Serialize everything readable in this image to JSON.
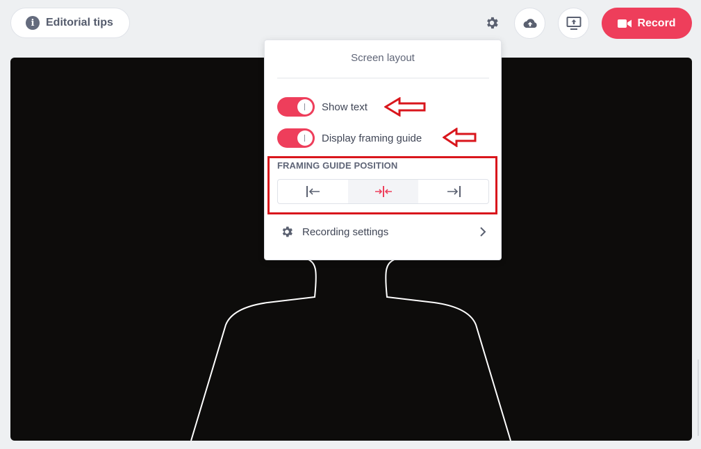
{
  "header": {
    "editorial_tips_label": "Editorial tips",
    "info_icon_glyph": "i",
    "record_label": "Record"
  },
  "popover": {
    "title": "Screen layout",
    "toggles": [
      {
        "label": "Show text",
        "on": true
      },
      {
        "label": "Display framing guide",
        "on": true
      }
    ],
    "framing_section_label": "FRAMING GUIDE POSITION",
    "framing_options": [
      "left",
      "center",
      "right"
    ],
    "framing_selected": "center",
    "recording_settings_label": "Recording settings"
  },
  "icons": {
    "info": "info-icon",
    "settings": "gear-icon",
    "upload": "cloud-upload-icon",
    "screen_share": "screen-share-icon",
    "record": "video-camera-icon",
    "chevron": "chevron-right-icon"
  },
  "colors": {
    "accent": "#ee3e5b",
    "annotation": "#d9161c",
    "video_background": "#0d0c0b"
  }
}
